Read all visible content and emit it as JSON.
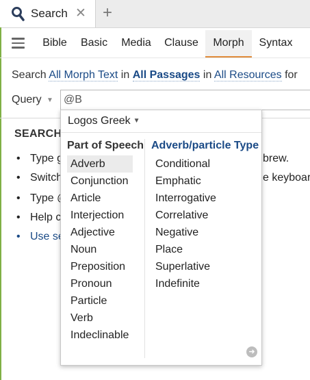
{
  "tab": {
    "title": "Search",
    "close": "✕",
    "new_tab": "+"
  },
  "search_types": [
    "Bible",
    "Basic",
    "Media",
    "Clause",
    "Morph",
    "Syntax"
  ],
  "search_line": {
    "prefix": "Search",
    "text_scope": "All Morph Text",
    "in1": "in",
    "passages": "All Passages",
    "in2": "in",
    "resources": "All Resources",
    "suffix": "for"
  },
  "query": {
    "label": "Query",
    "value": "@B"
  },
  "help": {
    "heading": "SEARCH",
    "items": [
      {
        "text": "Type g",
        "tail": "brew."
      },
      {
        "text": "Switch",
        "tail": "e keyboard"
      },
      {
        "text": "Type @",
        "tail": ""
      },
      {
        "text": "Help c",
        "tail": ""
      },
      {
        "text": "Use se",
        "tail": ""
      }
    ]
  },
  "dropdown": {
    "lexicon": "Logos Greek",
    "pos_heading": "Part of Speech",
    "pos_items": [
      "Adverb",
      "Conjunction",
      "Article",
      "Interjection",
      "Adjective",
      "Noun",
      "Preposition",
      "Pronoun",
      "Particle",
      "Verb",
      "Indeclinable"
    ],
    "selected_pos": "Adverb",
    "type_heading": "Adverb/particle Type",
    "type_items": [
      "Conditional",
      "Emphatic",
      "Interrogative",
      "Correlative",
      "Negative",
      "Place",
      "Superlative",
      "Indefinite"
    ]
  },
  "icons": {
    "tab_icon": "search-icon",
    "menu": "hamburger-menu-icon",
    "next": "next-arrow-icon"
  },
  "colors": {
    "link": "#1a4a86",
    "active_tab_underline": "#e08b3a",
    "accent_left": "#7fb045"
  }
}
